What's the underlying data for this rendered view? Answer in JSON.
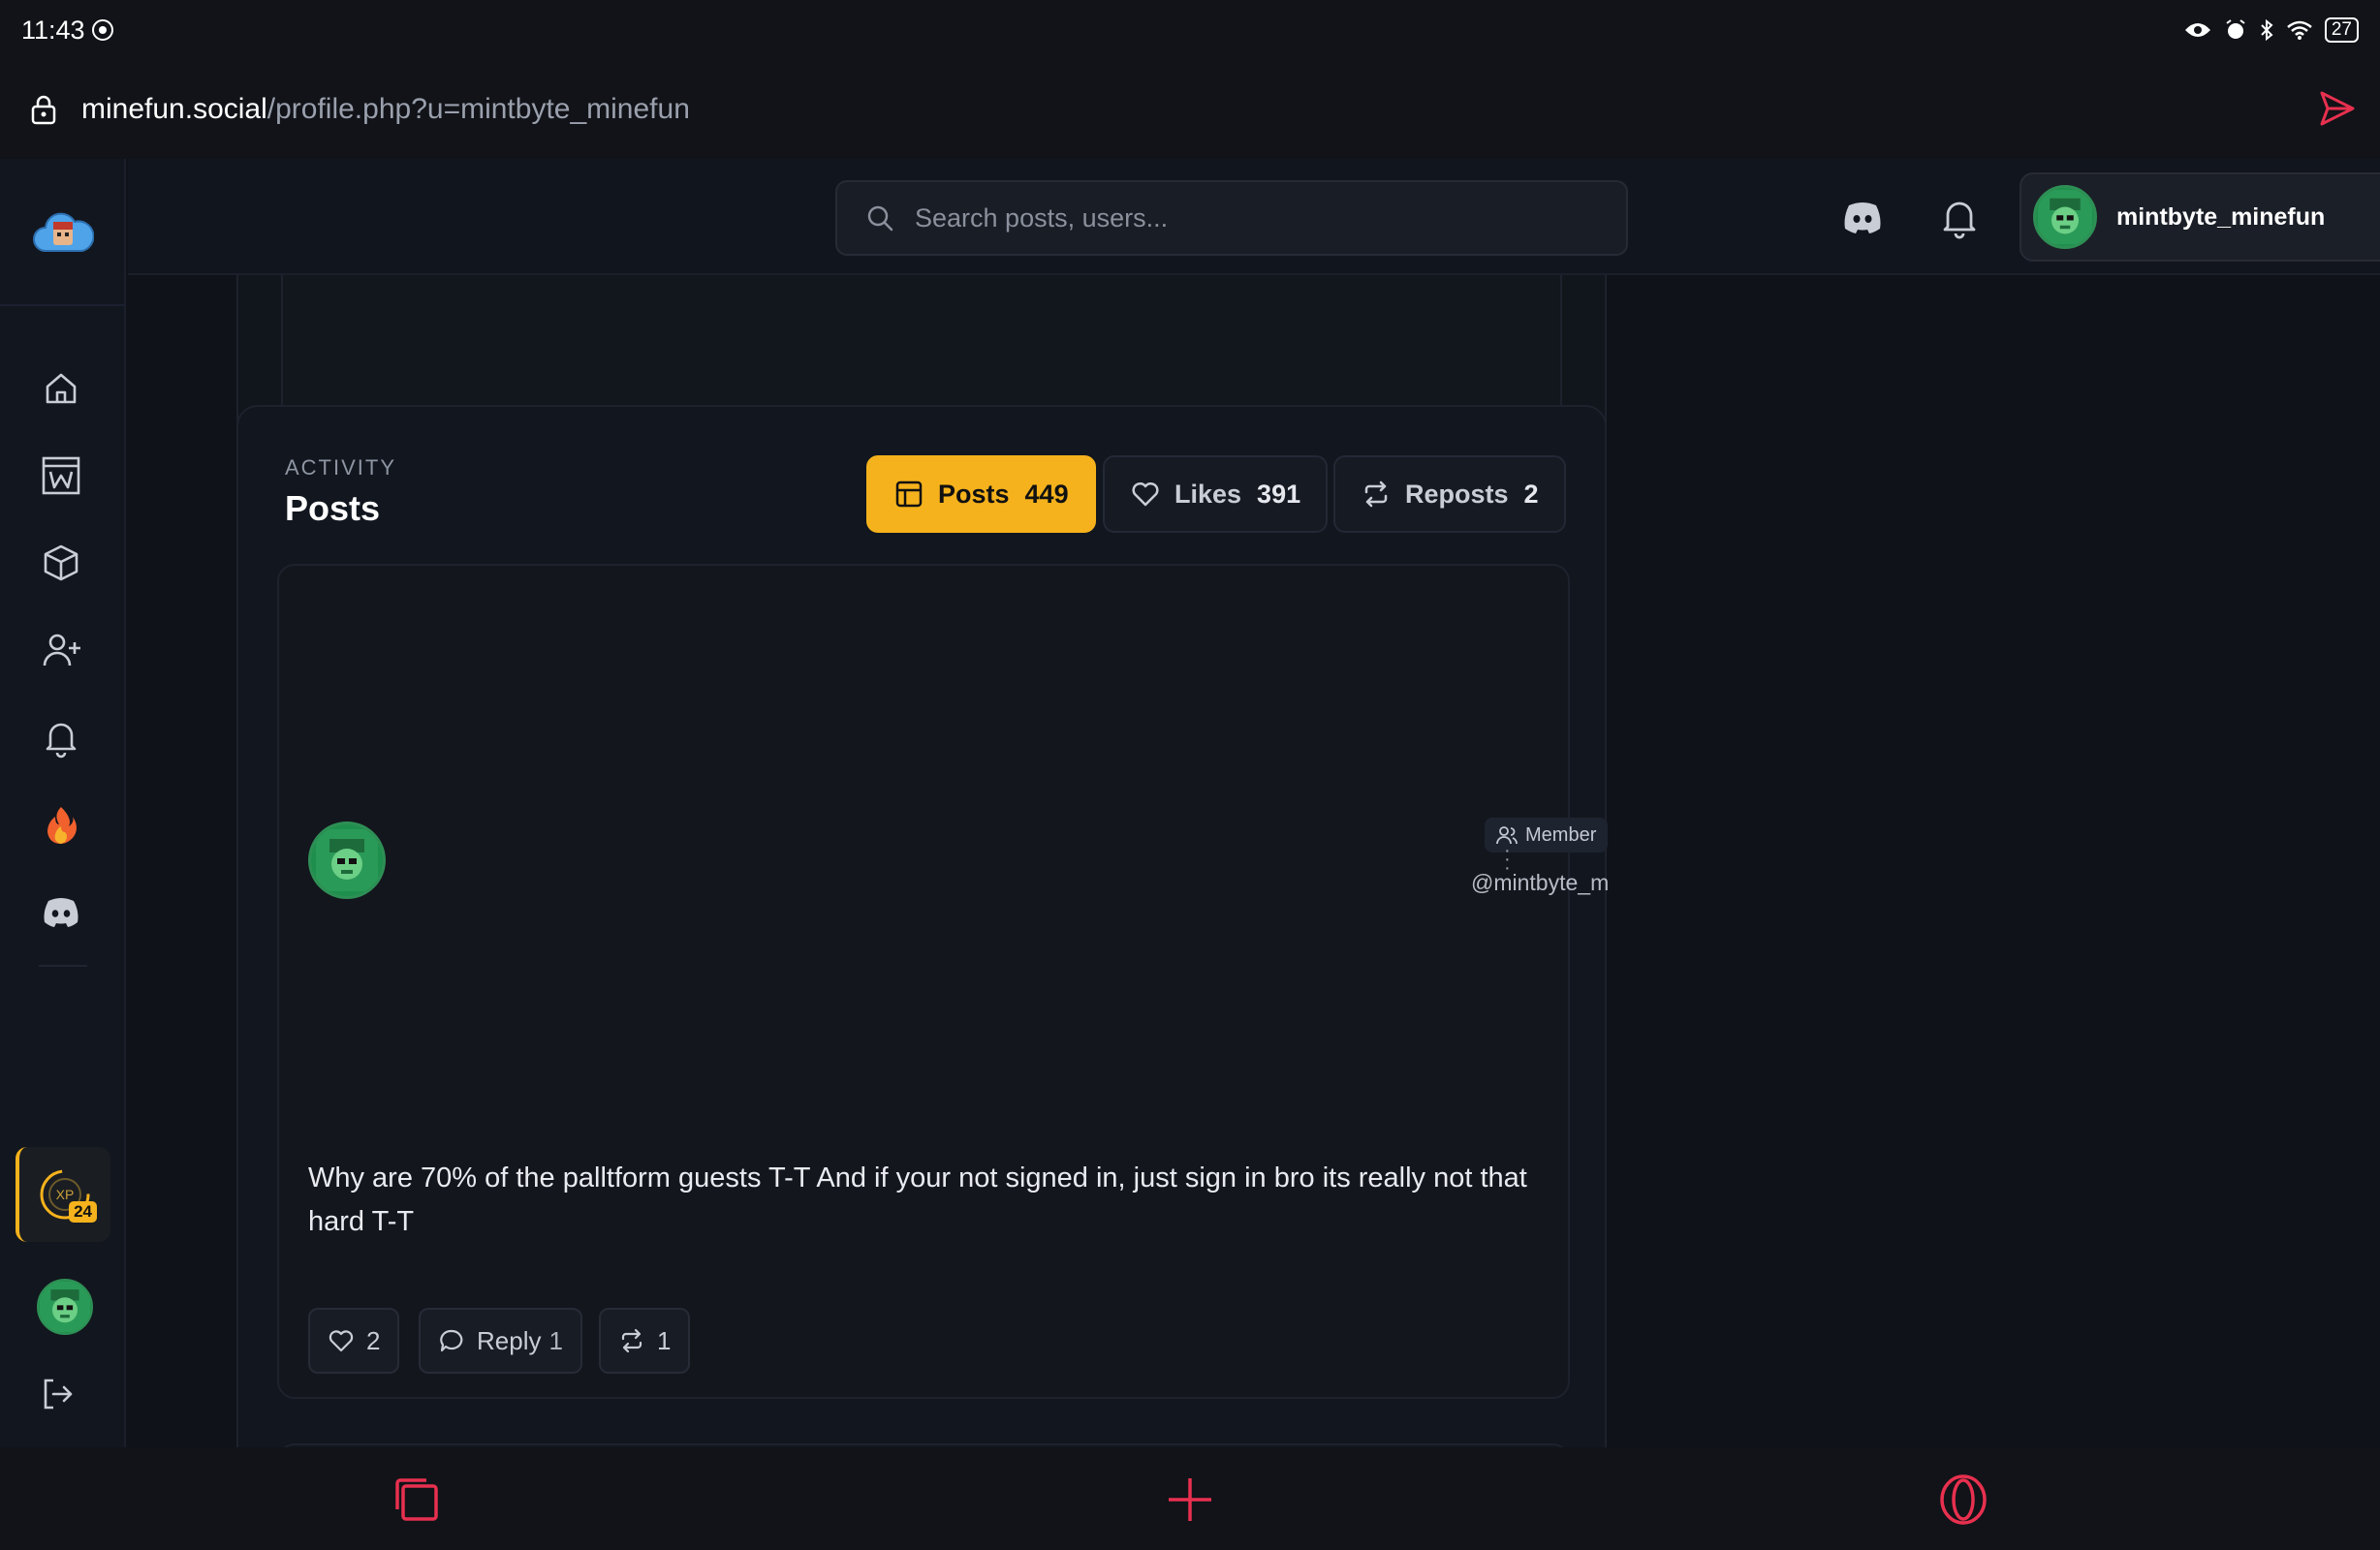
{
  "status_bar": {
    "time": "11:43",
    "battery": "27"
  },
  "browser": {
    "url_domain": "minefun.social",
    "url_path": "/profile.php?u=mintbyte_minefun"
  },
  "search": {
    "placeholder": "Search posts, users..."
  },
  "user": {
    "username": "mintbyte_minefun"
  },
  "sidebar": {
    "items": [
      {
        "name": "home",
        "icon": "home-icon"
      },
      {
        "name": "wiki",
        "icon": "wiki-icon"
      },
      {
        "name": "items",
        "icon": "cube-icon"
      },
      {
        "name": "add-friend",
        "icon": "user-plus-icon"
      },
      {
        "name": "notifications",
        "icon": "bell-icon"
      },
      {
        "name": "trending",
        "icon": "fire-icon"
      },
      {
        "name": "discord",
        "icon": "discord-icon"
      }
    ],
    "xp": {
      "label": "XP",
      "level": "24"
    }
  },
  "activity": {
    "eyebrow": "ACTIVITY",
    "title": "Posts",
    "tabs": [
      {
        "label": "Posts",
        "count": "449",
        "active": true
      },
      {
        "label": "Likes",
        "count": "391",
        "active": false
      },
      {
        "label": "Reposts",
        "count": "2",
        "active": false
      }
    ]
  },
  "post": {
    "badge": "Member",
    "handle": "@mintbyte_m",
    "body": "Why are 70% of the palltform guests T-T And if your not signed in, just sign in bro its really not that hard T-T",
    "likes": "2",
    "reply_label": "Reply",
    "replies": "1",
    "reposts": "1"
  },
  "colors": {
    "accent": "#f5b21c",
    "browser_accent": "#e8304f",
    "background": "#0f1218"
  }
}
